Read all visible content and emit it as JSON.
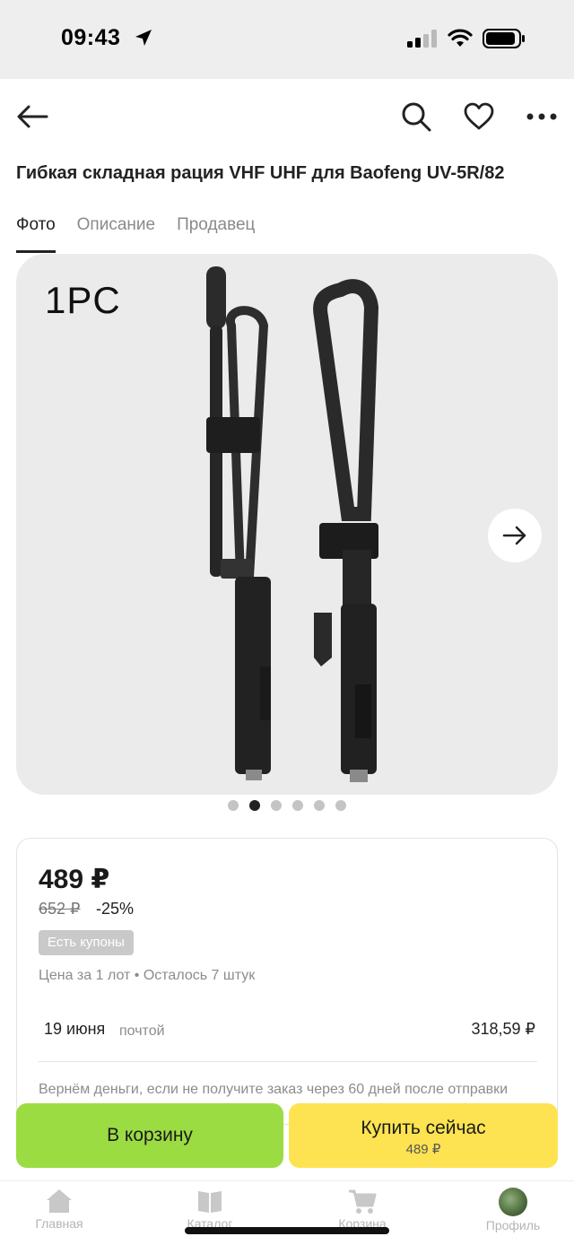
{
  "status_bar": {
    "time": "09:43"
  },
  "product": {
    "title": "Гибкая складная рация VHF UHF для Baofeng UV-5R/82"
  },
  "tabs": [
    {
      "label": "Фото",
      "active": true
    },
    {
      "label": "Описание",
      "active": false
    },
    {
      "label": "Продавец",
      "active": false
    }
  ],
  "gallery": {
    "image_label": "1PC",
    "current_index": 2,
    "total_images": 6
  },
  "price_card": {
    "price": "489 ₽",
    "old_price": "652 ₽",
    "discount": "-25%",
    "coupon_badge": "Есть купоны",
    "lot_info": "Цена за 1 лот • Осталось 7 штук",
    "delivery_date": "19 июня",
    "delivery_method": "почтой",
    "delivery_cost": "318,59 ₽",
    "refund_note": "Вернём деньги, если не получите заказ через 60 дней после отправки"
  },
  "actions": {
    "cart_label": "В корзину",
    "buy_label": "Купить сейчас",
    "buy_price": "489 ₽"
  },
  "bottom_nav": {
    "items": [
      {
        "label": "Главная",
        "icon": "home-icon"
      },
      {
        "label": "Каталог",
        "icon": "catalog-icon"
      },
      {
        "label": "Корзина",
        "icon": "cart-icon"
      },
      {
        "label": "Профиль",
        "icon": "avatar"
      }
    ]
  },
  "colors": {
    "cart_button": "#9bdc43",
    "buy_button": "#fde351",
    "gallery_bg": "#ebebeb",
    "status_bar_bg": "#eeeeef"
  }
}
